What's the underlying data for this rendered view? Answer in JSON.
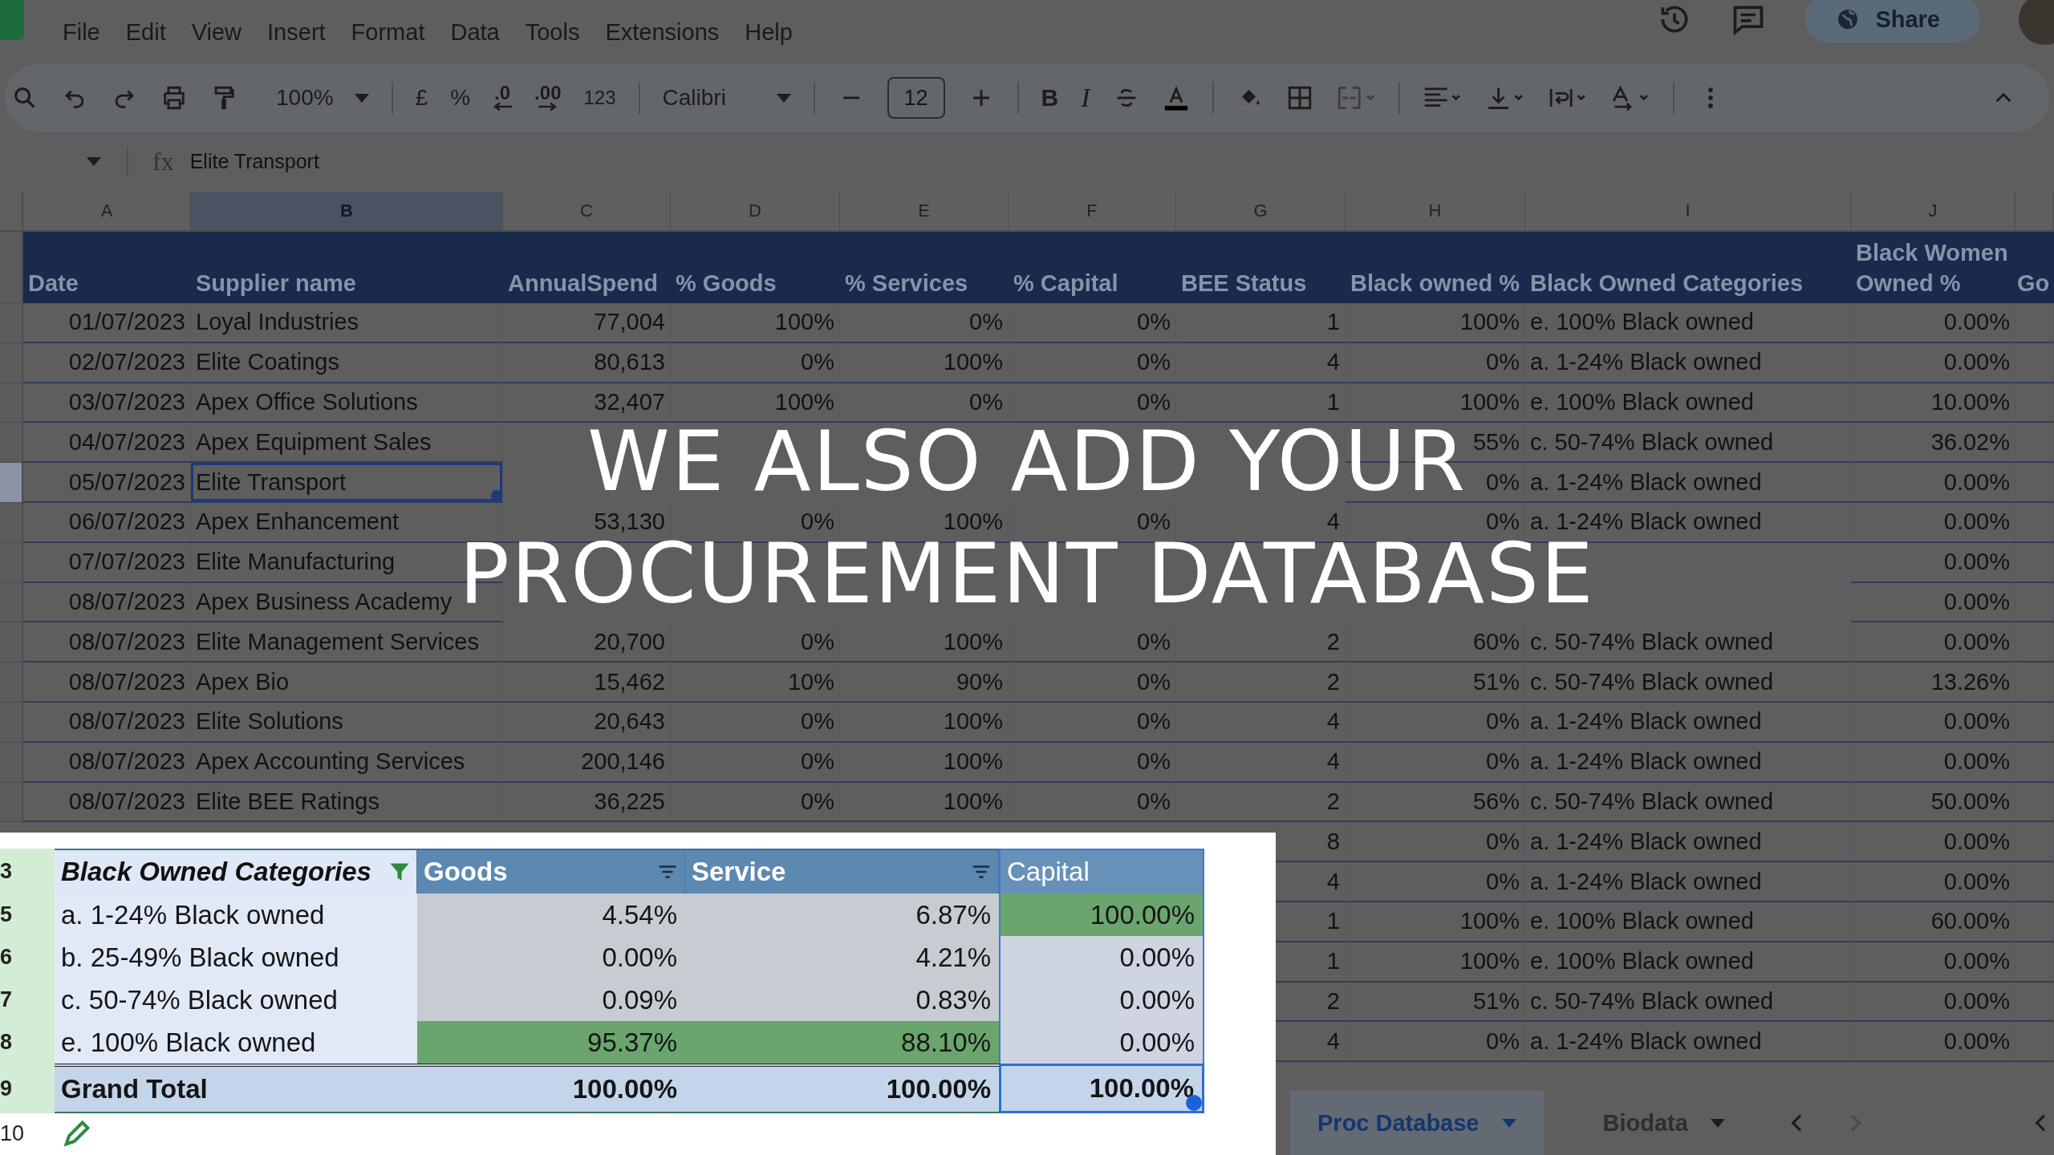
{
  "menu": [
    "File",
    "Edit",
    "View",
    "Insert",
    "Format",
    "Data",
    "Tools",
    "Extensions",
    "Help"
  ],
  "share_button": "Share",
  "toolbar": {
    "zoom": "100%",
    "currency": "£",
    "percent": "%",
    "decimal_decrease": ".0",
    "decimal_increase": ".00",
    "number_format": "123",
    "font": "Calibri",
    "font_size": "12",
    "bold": "B",
    "italic": "I"
  },
  "formula_bar": {
    "label": "fx",
    "value": "Elite Transport"
  },
  "columns": [
    {
      "letter": "A",
      "selected": false
    },
    {
      "letter": "B",
      "selected": true
    },
    {
      "letter": "C",
      "selected": false
    },
    {
      "letter": "D",
      "selected": false
    },
    {
      "letter": "E",
      "selected": false
    },
    {
      "letter": "F",
      "selected": false
    },
    {
      "letter": "G",
      "selected": false
    },
    {
      "letter": "H",
      "selected": false
    },
    {
      "letter": "I",
      "selected": false
    },
    {
      "letter": "J",
      "selected": false
    }
  ],
  "table": {
    "headers": [
      "Date",
      "Supplier name",
      "AnnualSpend",
      "% Goods",
      "% Services",
      "% Capital",
      "BEE Status",
      "Black owned %",
      "Black Owned Categories",
      "Black Women Owned %",
      "Go"
    ],
    "rows": [
      {
        "selected": false,
        "cells": [
          "01/07/2023",
          "Loyal Industries",
          "77,004",
          "100%",
          "0%",
          "0%",
          "1",
          "100%",
          "e. 100% Black owned",
          "0.00%"
        ]
      },
      {
        "selected": false,
        "cells": [
          "02/07/2023",
          "Elite Coatings",
          "80,613",
          "0%",
          "100%",
          "0%",
          "4",
          "0%",
          "a. 1-24% Black owned",
          "0.00%"
        ]
      },
      {
        "selected": false,
        "cells": [
          "03/07/2023",
          "Apex Office Solutions",
          "32,407",
          "100%",
          "0%",
          "0%",
          "1",
          "100%",
          "e. 100% Black owned",
          "10.00%"
        ]
      },
      {
        "selected": false,
        "cells": [
          "04/07/2023",
          "Apex Equipment Sales",
          null,
          null,
          null,
          null,
          null,
          "55%",
          "c. 50-74% Black owned",
          "36.02%"
        ]
      },
      {
        "selected": true,
        "cells": [
          "05/07/2023",
          "Elite Transport",
          null,
          null,
          null,
          null,
          null,
          "0%",
          "a. 1-24% Black owned",
          "0.00%"
        ]
      },
      {
        "selected": false,
        "cells": [
          "06/07/2023",
          "Apex Enhancement",
          "53,130",
          "0%",
          "100%",
          "0%",
          "4",
          "0%",
          "a. 1-24% Black owned",
          "0.00%"
        ]
      },
      {
        "selected": false,
        "cells": [
          "07/07/2023",
          "Elite Manufacturing",
          null,
          null,
          null,
          null,
          null,
          null,
          null,
          "0.00%"
        ]
      },
      {
        "selected": false,
        "cells": [
          "08/07/2023",
          "Apex Business Academy",
          null,
          null,
          null,
          null,
          null,
          null,
          null,
          "0.00%"
        ]
      },
      {
        "selected": false,
        "cells": [
          "08/07/2023",
          "Elite Management Services",
          "20,700",
          "0%",
          "100%",
          "0%",
          "2",
          "60%",
          "c. 50-74% Black owned",
          "0.00%"
        ]
      },
      {
        "selected": false,
        "cells": [
          "08/07/2023",
          "Apex Bio",
          "15,462",
          "10%",
          "90%",
          "0%",
          "2",
          "51%",
          "c. 50-74% Black owned",
          "13.26%"
        ]
      },
      {
        "selected": false,
        "cells": [
          "08/07/2023",
          "Elite Solutions",
          "20,643",
          "0%",
          "100%",
          "0%",
          "4",
          "0%",
          "a. 1-24% Black owned",
          "0.00%"
        ]
      },
      {
        "selected": false,
        "cells": [
          "08/07/2023",
          "Apex Accounting Services",
          "200,146",
          "0%",
          "100%",
          "0%",
          "4",
          "0%",
          "a. 1-24% Black owned",
          "0.00%"
        ]
      },
      {
        "selected": false,
        "cells": [
          "08/07/2023",
          "Elite BEE Ratings",
          "36,225",
          "0%",
          "100%",
          "0%",
          "2",
          "56%",
          "c. 50-74% Black owned",
          "50.00%"
        ]
      }
    ],
    "partial_rows": [
      {
        "bee_status": "8",
        "black_owned": "0%",
        "category": "a. 1-24% Black owned",
        "black_women": "0.00%"
      },
      {
        "bee_status": "4",
        "black_owned": "0%",
        "category": "a. 1-24% Black owned",
        "black_women": "0.00%"
      },
      {
        "bee_status": "1",
        "black_owned": "100%",
        "category": "e. 100% Black owned",
        "black_women": "60.00%"
      },
      {
        "bee_status": "1",
        "black_owned": "100%",
        "category": "e. 100% Black owned",
        "black_women": "0.00%"
      },
      {
        "bee_status": "2",
        "black_owned": "51%",
        "category": "c. 50-74% Black owned",
        "black_women": "0.00%"
      },
      {
        "bee_status": "4",
        "black_owned": "0%",
        "category": "a. 1-24% Black owned",
        "black_women": "0.00%"
      }
    ]
  },
  "pivot": {
    "header_number": "3",
    "headers": [
      {
        "text": "Black Owned Categories",
        "kind": "filtered"
      },
      {
        "text": "Goods",
        "kind": "sortable"
      },
      {
        "text": "Service",
        "kind": "sortable"
      },
      {
        "text": "Capital",
        "kind": "plain"
      }
    ],
    "rows": [
      {
        "number": "5",
        "label": "a. 1-24% Black owned",
        "cells": [
          {
            "text": "4.54%",
            "highlight": false
          },
          {
            "text": "6.87%",
            "highlight": false
          },
          {
            "text": "100.00%",
            "highlight": true
          }
        ]
      },
      {
        "number": "6",
        "label": "b. 25-49% Black owned",
        "cells": [
          {
            "text": "0.00%",
            "highlight": false
          },
          {
            "text": "4.21%",
            "highlight": false
          },
          {
            "text": "0.00%",
            "highlight": false
          }
        ]
      },
      {
        "number": "7",
        "label": "c. 50-74% Black owned",
        "cells": [
          {
            "text": "0.09%",
            "highlight": false
          },
          {
            "text": "0.83%",
            "highlight": false
          },
          {
            "text": "0.00%",
            "highlight": false
          }
        ]
      },
      {
        "number": "8",
        "label": "e. 100% Black owned",
        "cells": [
          {
            "text": "95.37%",
            "highlight": true
          },
          {
            "text": "88.10%",
            "highlight": true
          },
          {
            "text": "0.00%",
            "highlight": false
          }
        ]
      }
    ],
    "total": {
      "number": "9",
      "label": "Grand Total",
      "cells": [
        {
          "text": "100.00%",
          "selected": false
        },
        {
          "text": "100.00%",
          "selected": false
        },
        {
          "text": "100.00%",
          "selected": true
        }
      ]
    },
    "next_number": "10"
  },
  "sheet_tabs": [
    {
      "label": "Proc Database",
      "selected": true
    },
    {
      "label": "Biodata",
      "selected": false
    }
  ],
  "caption": [
    "WE ALSO ADD YOUR",
    "PROCUREMENT DATABASE"
  ]
}
